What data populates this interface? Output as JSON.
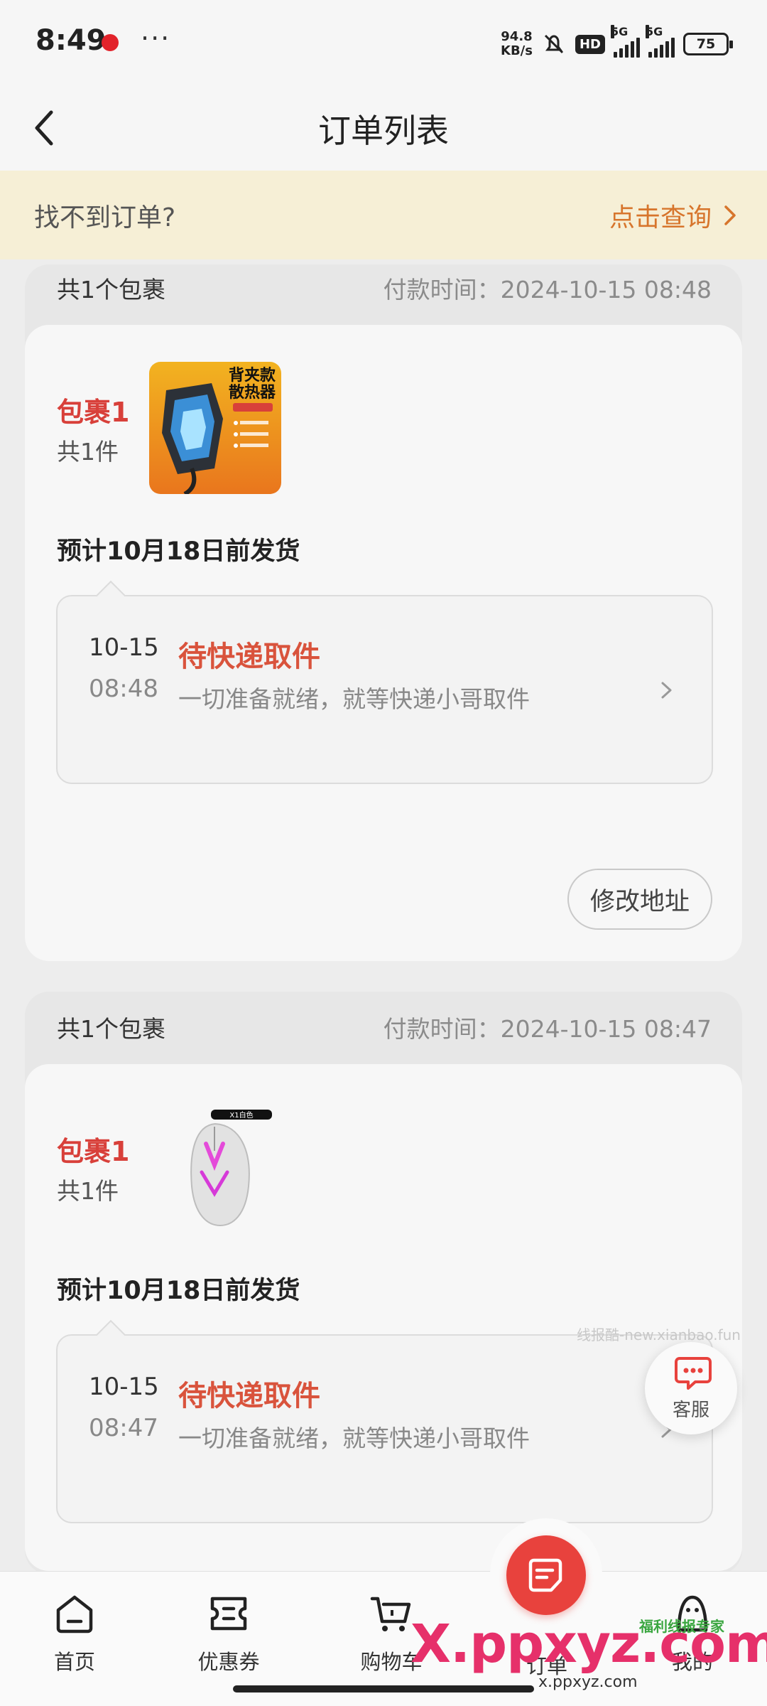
{
  "status_bar": {
    "time": "8:49",
    "dots": "···",
    "net_speed_value": "94.8",
    "net_speed_unit": "KB/s",
    "hd": "HD",
    "sig1": "5G",
    "sig2": "5G",
    "battery": "75"
  },
  "header": {
    "title": "订单列表"
  },
  "notice": {
    "text": "找不到订单?",
    "link": "点击查询"
  },
  "orders": [
    {
      "package_count": "共1个包裹",
      "pay_time": "付款时间：2024-10-15 08:48",
      "package_label": "包裹1",
      "item_count": "共1件",
      "product_text": [
        "背夹款",
        "散热器"
      ],
      "ship_estimate": "预计10月18日前发货",
      "track_date": "10-15",
      "track_time": "08:48",
      "track_status": "待快递取件",
      "track_desc": "一切准备就绪，就等快递小哥取件",
      "action": "修改地址"
    },
    {
      "package_count": "共1个包裹",
      "pay_time": "付款时间：2024-10-15 08:47",
      "package_label": "包裹1",
      "item_count": "共1件",
      "product_tag": "X1白色",
      "ship_estimate": "预计10月18日前发货",
      "track_date": "10-15",
      "track_time": "08:47",
      "track_status": "待快递取件",
      "track_desc": "一切准备就绪，就等快递小哥取件"
    }
  ],
  "service": {
    "label": "客服"
  },
  "nav": {
    "home": "首页",
    "coupon": "优惠券",
    "cart": "购物车",
    "orders": "订单",
    "me": "我的"
  },
  "watermarks": {
    "small": "线报酷-new.xianbao.fun",
    "big": "X.ppxyz.com",
    "sub": "x.ppxyz.com",
    "green": "福利线报专家"
  },
  "colors": {
    "accent_red": "#d8403a",
    "status_orange": "#d9533c",
    "notice_bg": "#f6efd6",
    "notice_link": "#d7752c"
  }
}
